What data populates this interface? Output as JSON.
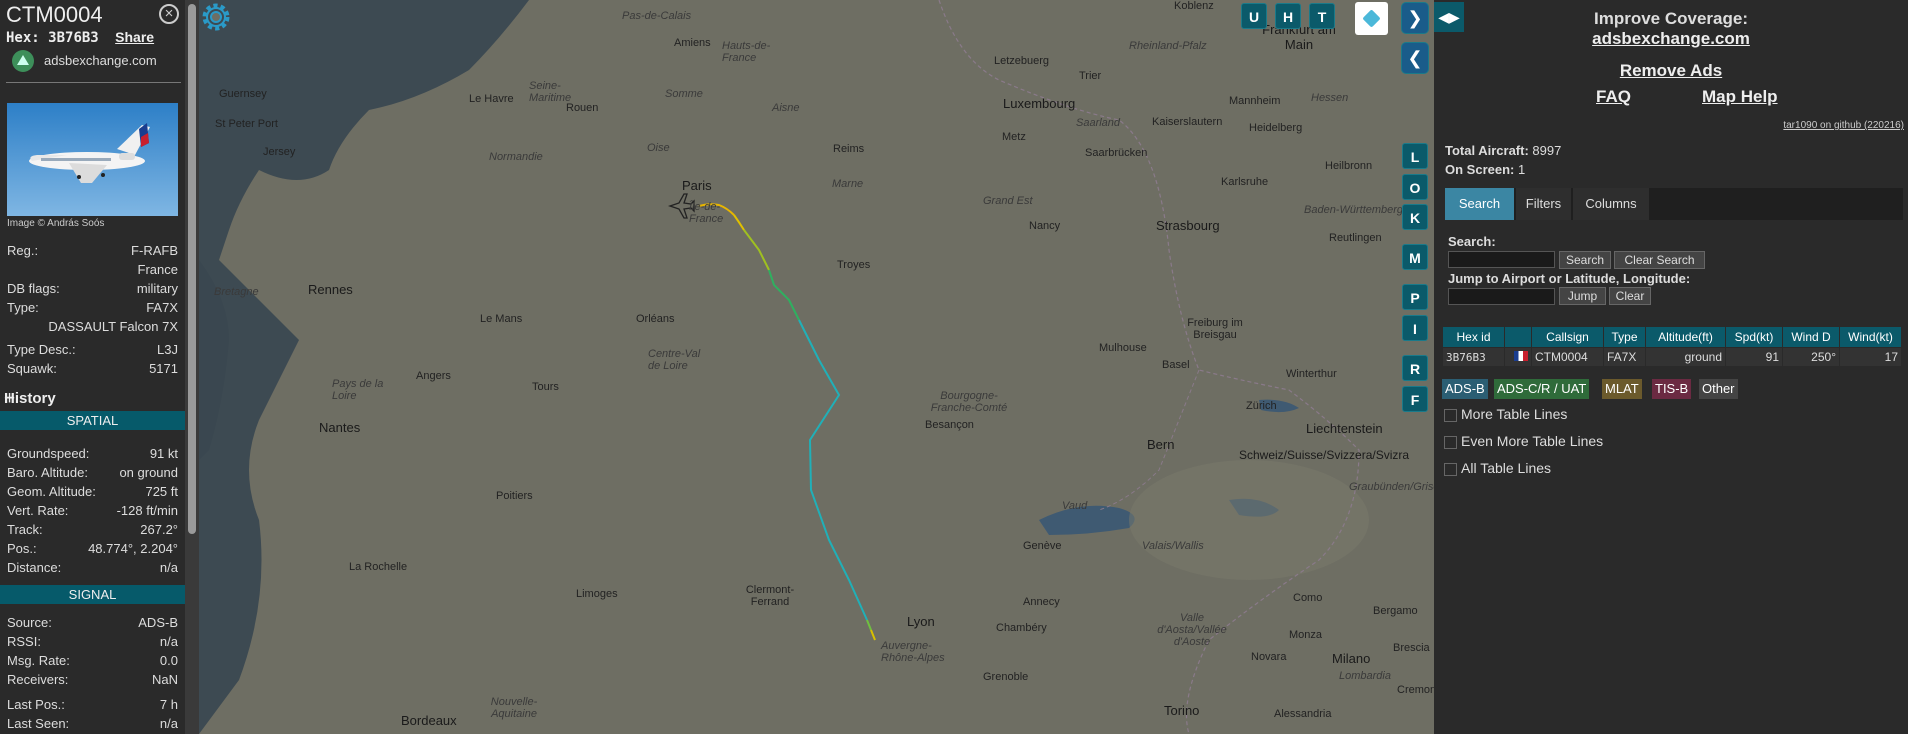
{
  "aircraft": {
    "callsign": "CTM0004",
    "hex_label": "Hex:",
    "hex": "3B76B3",
    "share": "Share",
    "source_site": "adsbexchange.com",
    "image_credit": "Image © András Soós",
    "reg_label": "Reg.:",
    "reg": "F-RAFB",
    "country": "France",
    "dbflags_label": "DB flags:",
    "dbflags": "military",
    "type_label": "Type:",
    "type": "FA7X",
    "type_name": "DASSAULT Falcon 7X",
    "typedesc_label": "Type Desc.:",
    "typedesc": "L3J",
    "squawk_label": "Squawk:",
    "squawk": "5171"
  },
  "history": {
    "label": "History",
    "plus": "+"
  },
  "spatial": {
    "band": "SPATIAL",
    "rows": [
      {
        "label": "Groundspeed:",
        "value": "91 kt"
      },
      {
        "label": "Baro. Altitude:",
        "value": "on ground"
      },
      {
        "label": "Geom. Altitude:",
        "value": "725 ft"
      },
      {
        "label": "Vert. Rate:",
        "value": "-128 ft/min"
      },
      {
        "label": "Track:",
        "value": "267.2°"
      },
      {
        "label": "Pos.:",
        "value": "48.774°, 2.204°"
      },
      {
        "label": "Distance:",
        "value": "n/a"
      }
    ]
  },
  "signal": {
    "band": "SIGNAL",
    "rows": [
      {
        "label": "Source:",
        "value": "ADS-B"
      },
      {
        "label": "RSSI:",
        "value": "n/a"
      },
      {
        "label": "Msg. Rate:",
        "value": "0.0"
      },
      {
        "label": "Receivers:",
        "value": "NaN"
      },
      {
        "label": "Last Pos.:",
        "value": "7 h"
      },
      {
        "label": "Last Seen:",
        "value": "n/a"
      }
    ]
  },
  "map": {
    "top_buttons": [
      "U",
      "H",
      "T"
    ],
    "side_buttons": [
      "L",
      "O",
      "K",
      "M",
      "P",
      "I",
      "R",
      "F"
    ],
    "nav_forward": "❯",
    "nav_back": "❮",
    "labels": {
      "cities": [
        "Paris",
        "Amiens",
        "Rouen",
        "Le Havre",
        "Reims",
        "Troyes",
        "Orléans",
        "Rennes",
        "Le Mans",
        "Angers",
        "Tours",
        "Nantes",
        "Poitiers",
        "La Rochelle",
        "Limoges",
        "Clermont-Ferrand",
        "Lyon",
        "Grenoble",
        "Annecy",
        "Chambéry",
        "Genève",
        "Bern",
        "Basel",
        "Mulhouse",
        "Strasbourg",
        "Nancy",
        "Luxembourg",
        "Metz",
        "Trier",
        "Koblenz",
        "Frankfurt am Main",
        "Mannheim",
        "Heidelberg",
        "Karlsruhe",
        "Saarbrücken",
        "Kaiserslautern",
        "Heilbronn",
        "Reutlingen",
        "Freiburg im Breisgau",
        "Zürich",
        "Winterthur",
        "Liechtenstein",
        "Besançon",
        "Milano",
        "Torino",
        "Como",
        "Bergamo",
        "Brescia",
        "Monza",
        "Cremona",
        "Alessandria",
        "Novara",
        "Bordeaux",
        "St Peter Port",
        "Guernsey",
        "Jersey",
        "Letzebuerg"
      ],
      "regions": [
        "Normandie",
        "Bretagne",
        "Île-de-France",
        "Hauts-de-France",
        "Grand Est",
        "Centre-Val de Loire",
        "Pays de la Loire",
        "Bourgogne-Franche-Comté",
        "Auvergne-Rhône-Alpes",
        "Nouvelle-Aquitaine",
        "Baden-Württemberg",
        "Saarland",
        "Rheinland-Pfalz",
        "Schweiz/Suisse/Svizzera/Svizra",
        "Valais/Wallis",
        "Vaud",
        "Graubünden/Grischun/Grigioni",
        "Valle d'Aosta/Vallée d'Aoste",
        "Lombardia",
        "Somme",
        "Aisne",
        "Marne",
        "Oise",
        "Seine-Maritime",
        "Pas-de-Calais",
        "Hessen"
      ]
    }
  },
  "right": {
    "toggle": "◀▶",
    "coverage_line1": "Improve Coverage:",
    "coverage_line2": "adsbexchange.com",
    "remove_ads": "Remove Ads",
    "faq": "FAQ",
    "map_help": "Map Help",
    "git": "tar1090 on github (220216)",
    "total_label": "Total Aircraft:",
    "total": "8997",
    "onscreen_label": "On Screen:",
    "onscreen": "1",
    "tabs": [
      "Search",
      "Filters",
      "Columns"
    ],
    "search_label": "Search:",
    "search_btn": "Search",
    "clear_search_btn": "Clear Search",
    "jump_label": "Jump to Airport or Latitude, Longitude:",
    "jump_btn": "Jump",
    "clear_btn": "Clear",
    "table": {
      "headers": [
        "Hex id",
        "",
        "Callsign",
        "Type",
        "Altitude(ft)",
        "Spd(kt)",
        "Wind D",
        "Wind(kt)"
      ],
      "rows": [
        [
          "3B76B3",
          "",
          "CTM0004",
          "FA7X",
          "ground",
          "91",
          "250°",
          "17"
        ]
      ]
    },
    "legend": [
      {
        "label": "ADS-B",
        "color": "#2b5e73"
      },
      {
        "label": "ADS-C/R / UAT",
        "color": "#2f6b3a"
      },
      {
        "label": "MLAT",
        "color": "#6b5a2c"
      },
      {
        "label": "TIS-B",
        "color": "#6b2a42"
      },
      {
        "label": "Other",
        "color": "#444444"
      }
    ],
    "checkboxes": [
      "More Table Lines",
      "Even More Table Lines",
      "All Table Lines"
    ]
  }
}
